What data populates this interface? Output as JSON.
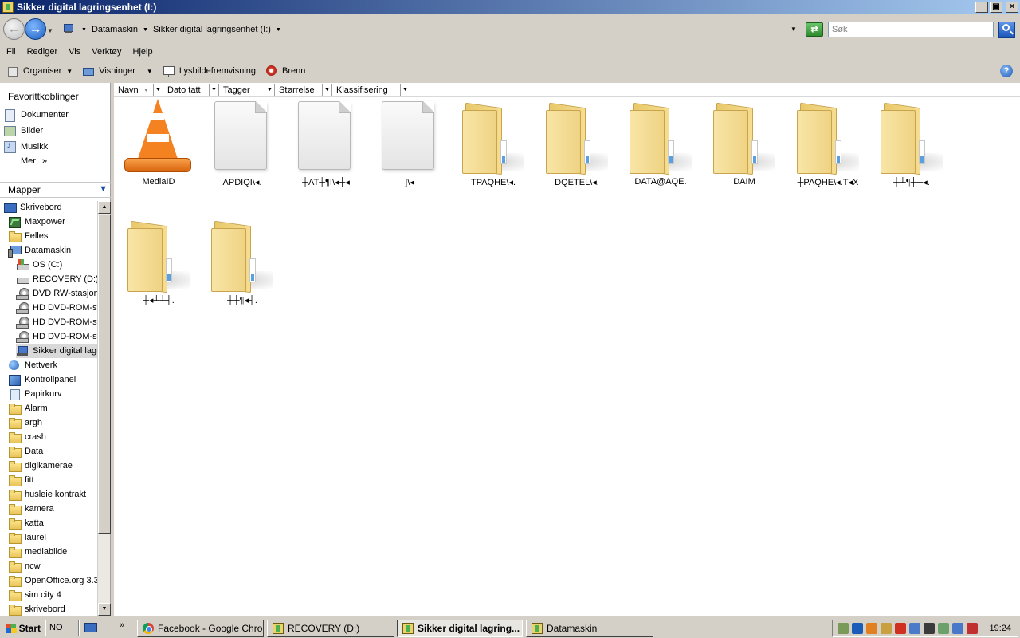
{
  "window": {
    "title": "Sikker digital lagringsenhet (I:)",
    "buttons": {
      "minimize": "_",
      "maximize": "▣",
      "close": "×"
    }
  },
  "address": {
    "breadcrumbs": [
      "Datamaskin",
      "Sikker digital lagringsenhet (I:)"
    ],
    "search_placeholder": "Søk"
  },
  "menu": [
    "Fil",
    "Rediger",
    "Vis",
    "Verktøy",
    "Hjelp"
  ],
  "toolbar": {
    "organize": "Organiser",
    "views": "Visninger",
    "slideshow": "Lysbildefremvisning",
    "burn": "Brenn"
  },
  "favorites": {
    "title": "Favorittkoblinger",
    "items": [
      "Dokumenter",
      "Bilder",
      "Musikk"
    ],
    "more": "Mer",
    "more_glyph": "»"
  },
  "folders_header": "Mapper",
  "tree": [
    {
      "label": "Skrivebord",
      "icon": "desktop-icon",
      "indent": 0
    },
    {
      "label": "Maxpower",
      "icon": "user-icon",
      "indent": 1
    },
    {
      "label": "Felles",
      "icon": "folder-icon",
      "indent": 1
    },
    {
      "label": "Datamaskin",
      "icon": "computer-icon",
      "indent": 1
    },
    {
      "label": "OS (C:)",
      "icon": "c-drive-icon",
      "indent": 2
    },
    {
      "label": "RECOVERY (D:)",
      "icon": "drive-icon",
      "indent": 2
    },
    {
      "label": "DVD RW-stasjon",
      "icon": "dvd-drive-icon",
      "indent": 2
    },
    {
      "label": "HD DVD-ROM-st",
      "icon": "dvd-drive-icon",
      "indent": 2
    },
    {
      "label": "HD DVD-ROM-st",
      "icon": "dvd-drive-icon",
      "indent": 2
    },
    {
      "label": "HD DVD-ROM-st",
      "icon": "dvd-drive-icon",
      "indent": 2
    },
    {
      "label": "Sikker digital lagr",
      "icon": "usb-drive-icon",
      "indent": 2,
      "selected": true
    },
    {
      "label": "Nettverk",
      "icon": "network-icon",
      "indent": 1
    },
    {
      "label": "Kontrollpanel",
      "icon": "control-panel-icon",
      "indent": 1
    },
    {
      "label": "Papirkurv",
      "icon": "recycle-bin-icon",
      "indent": 1
    },
    {
      "label": "Alarm",
      "icon": "folder-icon",
      "indent": 1
    },
    {
      "label": "argh",
      "icon": "folder-icon",
      "indent": 1
    },
    {
      "label": "crash",
      "icon": "folder-icon",
      "indent": 1
    },
    {
      "label": "Data",
      "icon": "folder-icon",
      "indent": 1
    },
    {
      "label": "digikamerae",
      "icon": "folder-icon",
      "indent": 1
    },
    {
      "label": "fitt",
      "icon": "folder-icon",
      "indent": 1
    },
    {
      "label": "husleie kontrakt",
      "icon": "folder-icon",
      "indent": 1
    },
    {
      "label": "kamera",
      "icon": "folder-icon",
      "indent": 1
    },
    {
      "label": "katta",
      "icon": "folder-icon",
      "indent": 1
    },
    {
      "label": "laurel",
      "icon": "folder-icon",
      "indent": 1
    },
    {
      "label": "mediabilde",
      "icon": "folder-icon",
      "indent": 1
    },
    {
      "label": "ncw",
      "icon": "folder-icon",
      "indent": 1
    },
    {
      "label": "OpenOffice.org 3.3",
      "icon": "folder-icon",
      "indent": 1
    },
    {
      "label": "sim city 4",
      "icon": "folder-icon",
      "indent": 1
    },
    {
      "label": "skrivebord",
      "icon": "folder-icon",
      "indent": 1
    }
  ],
  "columns": [
    "Navn",
    "Dato tatt",
    "Tagger",
    "Størrelse",
    "Klassifisering"
  ],
  "items": [
    {
      "label": "MediaID",
      "kind": "vlc"
    },
    {
      "label": "APDIQI\\◂.",
      "kind": "file"
    },
    {
      "label": "┼AT┼¶I\\◂┼◂",
      "kind": "file"
    },
    {
      "label": "]\\◂",
      "kind": "file"
    },
    {
      "label": "TPAQHE\\◂.",
      "kind": "folder"
    },
    {
      "label": "DQETEL\\◂.",
      "kind": "folder"
    },
    {
      "label": "DATA@AQE.",
      "kind": "folder"
    },
    {
      "label": "DAIM",
      "kind": "folder"
    },
    {
      "label": "┼PAQHE\\◂.T◂X",
      "kind": "folder"
    },
    {
      "label": "┼┴¶┼┼◂.",
      "kind": "folder"
    },
    {
      "label": "┼◂┴┴┤.",
      "kind": "folder"
    },
    {
      "label": "┼┼¶◂┤.",
      "kind": "folder"
    }
  ],
  "taskbar": {
    "start": "Start",
    "language": "NO",
    "overflow": "»",
    "tasks": [
      {
        "label": "Facebook - Google Chrome",
        "icon": "chrome-icon",
        "active": false
      },
      {
        "label": "RECOVERY (D:)",
        "icon": "explorer-icon",
        "active": false
      },
      {
        "label": "Sikker digital lagring...",
        "icon": "explorer-icon",
        "active": true
      },
      {
        "label": "Datamaskin",
        "icon": "explorer-icon",
        "active": false
      }
    ],
    "clock": "19:24",
    "tray_colors": [
      "#7a9a5a",
      "#1a5cb8",
      "#e08020",
      "#c8a040",
      "#d03020",
      "#4a7ac8",
      "#3a3a3a",
      "#6aa06a",
      "#4a78c8",
      "#c03030"
    ]
  }
}
